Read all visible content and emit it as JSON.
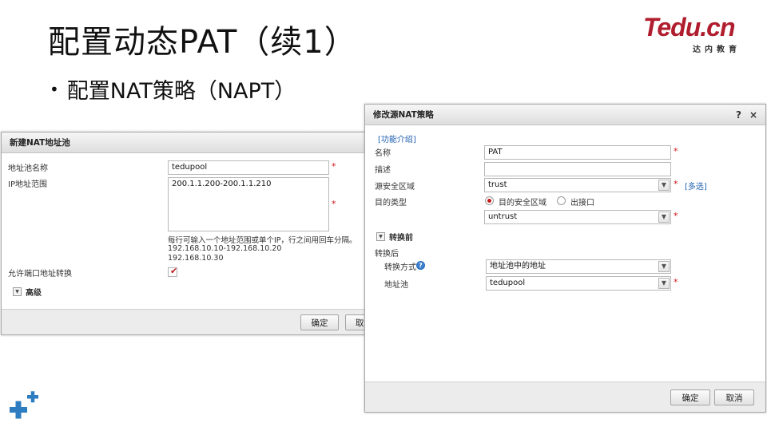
{
  "slide": {
    "title": "配置动态PAT（续1）",
    "bullet": "配置NAT策略（NAPT）"
  },
  "brand": {
    "logo_text": "Tedu.cn",
    "logo_sub": "达内教育",
    "colors": {
      "logo_red": "#b01d2e",
      "plus_blue": "#2f7dc1"
    }
  },
  "pool_dialog": {
    "title": "新建NAT地址池",
    "name_label": "地址池名称",
    "name_value": "tedupool",
    "range_label": "IP地址范围",
    "range_value": "200.1.1.200-200.1.1.210",
    "hint_line1": "每行可输入一个地址范围或单个IP，行之间用回车分隔。",
    "hint_line2": "192.168.10.10-192.168.10.20",
    "hint_line3": "192.168.10.30",
    "allow_port_label": "允许端口地址转换",
    "allow_port_checked": true,
    "advanced_label": "高级",
    "ok_label": "确定",
    "cancel_label": "取消",
    "required_mark": "*"
  },
  "nat_dialog": {
    "title": "修改源NAT策略",
    "help_icon": "?",
    "close_icon": "×",
    "intro_link": "[功能介绍]",
    "name_label": "名称",
    "name_value": "PAT",
    "desc_label": "描述",
    "desc_value": "",
    "src_zone_label": "源安全区域",
    "src_zone_value": "trust",
    "multi_select_link": "[多选]",
    "dest_type_label": "目的类型",
    "dest_type_option1": "目的安全区域",
    "dest_type_option2": "出接口",
    "dest_type_selected": "目的安全区域",
    "dest_zone_value": "untrust",
    "before_section": "转换前",
    "after_section": "转换后",
    "method_label": "转换方式",
    "method_value": "地址池中的地址",
    "pool_label": "地址池",
    "pool_value": "tedupool",
    "ok_label": "确定",
    "cancel_label": "取消",
    "required_mark": "*"
  }
}
